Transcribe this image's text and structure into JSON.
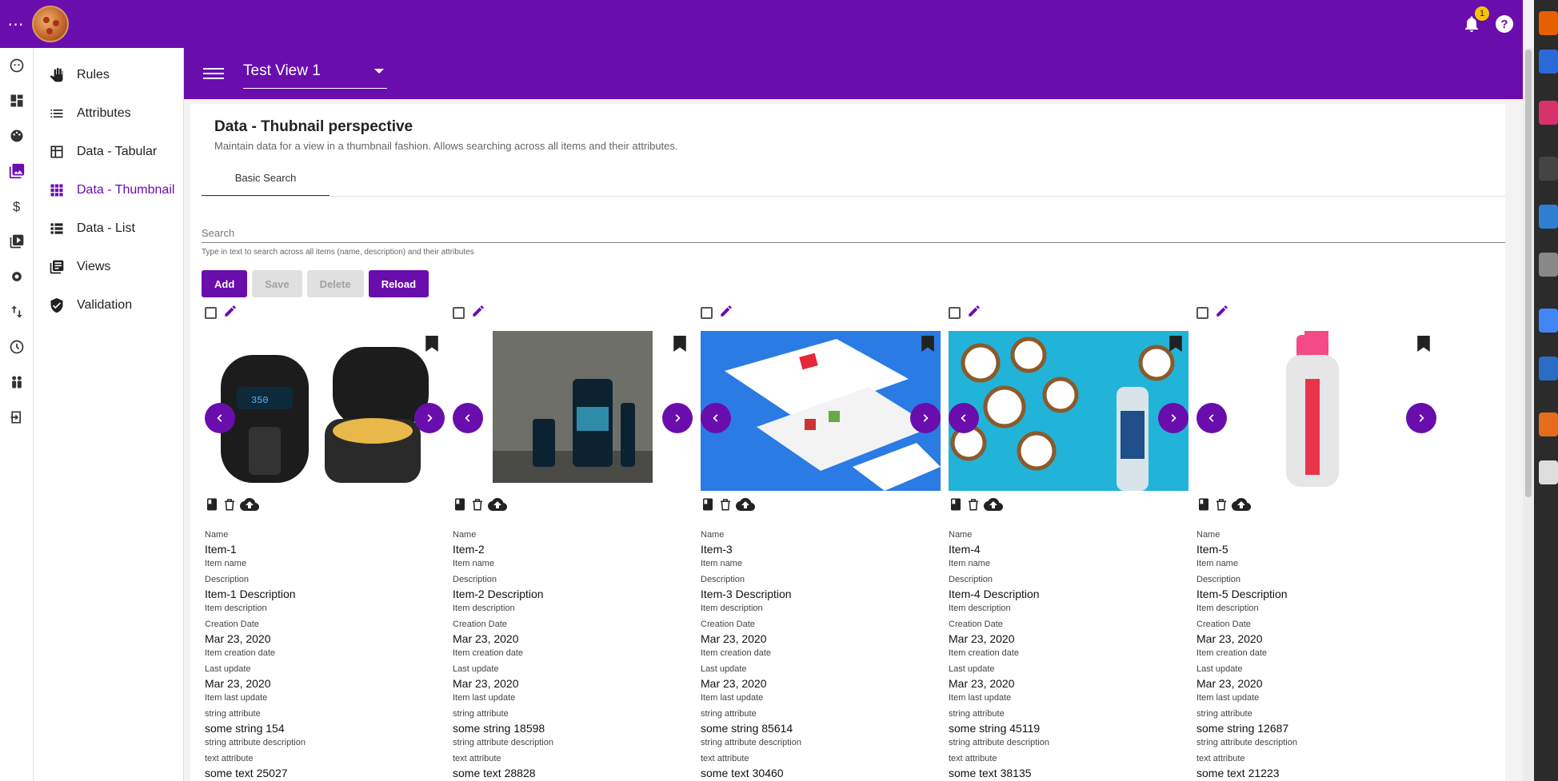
{
  "header": {
    "menu_glyph": "⋯",
    "notification_count": "1",
    "help_glyph": "?"
  },
  "nav_rail": [
    "face-icon",
    "dashboard-icon",
    "palette-icon",
    "photo-library-icon",
    "dollar-icon",
    "video-library-icon",
    "settings-icon",
    "sort-icon",
    "history-icon",
    "people-icon",
    "logout-icon"
  ],
  "sidebar": {
    "items": [
      {
        "label": "Rules",
        "icon": "hand-icon",
        "active": false
      },
      {
        "label": "Attributes",
        "icon": "list-icon",
        "active": false
      },
      {
        "label": "Data - Tabular",
        "icon": "table-icon",
        "active": false
      },
      {
        "label": "Data - Thumbnail",
        "icon": "grid-icon",
        "active": true
      },
      {
        "label": "Data - List",
        "icon": "list-view-icon",
        "active": false
      },
      {
        "label": "Views",
        "icon": "library-icon",
        "active": false
      },
      {
        "label": "Validation",
        "icon": "shield-check-icon",
        "active": false
      }
    ]
  },
  "view_selector": {
    "value": "Test View 1"
  },
  "page": {
    "title": "Data - Thubnail perspective",
    "subtitle": "Maintain data for a view in a thumbnail fashion. Allows searching across all items and their attributes.",
    "tab": "Basic Search",
    "search_placeholder": "Search",
    "search_hint": "Type in text to search across all items (name, description) and their attributes"
  },
  "buttons": {
    "add": "Add",
    "save": "Save",
    "delete": "Delete",
    "reload": "Reload"
  },
  "field_labels": {
    "name": "Name",
    "name_desc": "Item name",
    "description": "Description",
    "description_desc": "Item description",
    "creation": "Creation Date",
    "creation_desc": "Item creation date",
    "last_update": "Last update",
    "last_update_desc": "Item last update",
    "string_attr": "string attribute",
    "string_attr_desc": "string attribute description",
    "text_attr": "text attribute"
  },
  "items": [
    {
      "name": "Item-1",
      "description": "Item-1 Description",
      "creation_date": "Mar 23, 2020",
      "last_update": "Mar 23, 2020",
      "string_value": "some string 154",
      "text_value": "some text 25027",
      "image": "air-fryer"
    },
    {
      "name": "Item-2",
      "description": "Item-2 Description",
      "creation_date": "Mar 23, 2020",
      "last_update": "Mar 23, 2020",
      "string_value": "some string 18598",
      "text_value": "some text 28828",
      "image": "oil-bottles"
    },
    {
      "name": "Item-3",
      "description": "Item-3 Description",
      "creation_date": "Mar 23, 2020",
      "last_update": "Mar 23, 2020",
      "string_value": "some string 85614",
      "text_value": "some text 30460",
      "image": "web-screens"
    },
    {
      "name": "Item-4",
      "description": "Item-4 Description",
      "creation_date": "Mar 23, 2020",
      "last_update": "Mar 23, 2020",
      "string_value": "some string 45119",
      "text_value": "some text 38135",
      "image": "coconuts-spray"
    },
    {
      "name": "Item-5",
      "description": "Item-5 Description",
      "creation_date": "Mar 23, 2020",
      "last_update": "Mar 23, 2020",
      "string_value": "some string 12687",
      "text_value": "some text 21223",
      "image": "texture-bottle"
    }
  ],
  "colors": {
    "primary": "#6a0dad",
    "badge": "#f6c400"
  }
}
